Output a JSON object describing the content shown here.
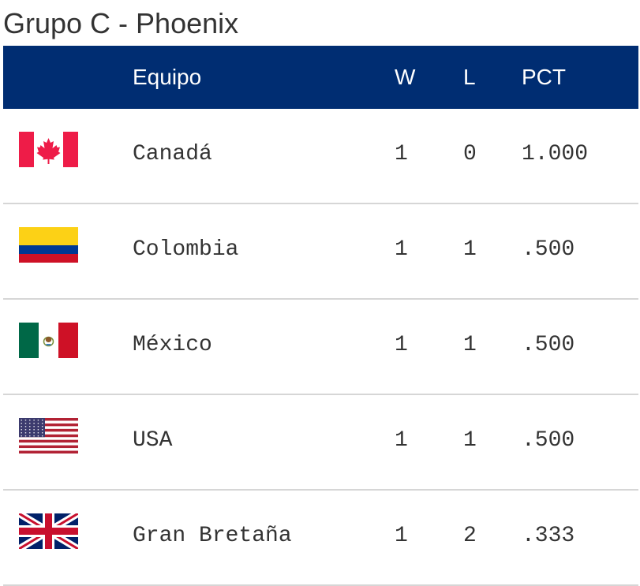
{
  "title": "Grupo C - Phoenix",
  "columns": {
    "team": "Equipo",
    "w": "W",
    "l": "L",
    "pct": "PCT"
  },
  "rows": [
    {
      "flag": "canada-flag-icon",
      "team": "Canadá",
      "w": "1",
      "l": "0",
      "pct": "1.000"
    },
    {
      "flag": "colombia-flag-icon",
      "team": "Colombia",
      "w": "1",
      "l": "1",
      "pct": ".500"
    },
    {
      "flag": "mexico-flag-icon",
      "team": "México",
      "w": "1",
      "l": "1",
      "pct": ".500"
    },
    {
      "flag": "usa-flag-icon",
      "team": "USA",
      "w": "1",
      "l": "1",
      "pct": ".500"
    },
    {
      "flag": "great-britain-flag-icon",
      "team": "Gran Bretaña",
      "w": "1",
      "l": "2",
      "pct": ".333"
    }
  ],
  "colors": {
    "header_bg": "#002d72",
    "header_text": "#ffffff",
    "row_divider": "#d6d6d6",
    "text": "#333333"
  }
}
